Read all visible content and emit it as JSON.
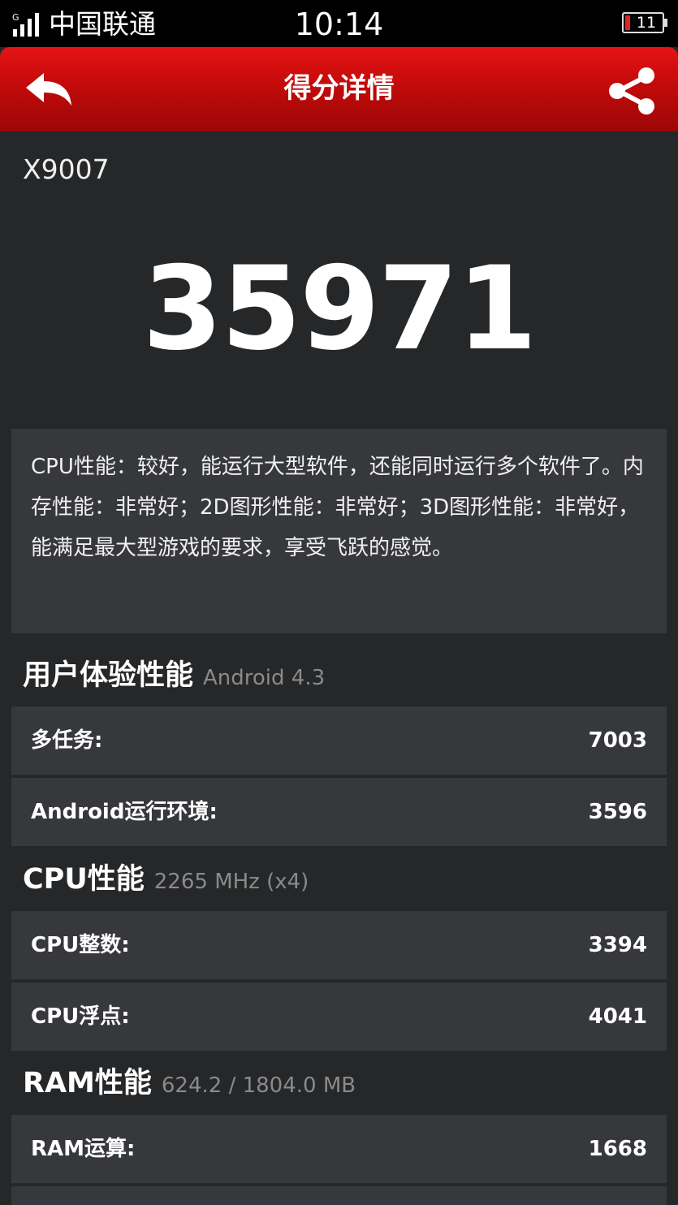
{
  "status_bar": {
    "carrier": "中国联通",
    "time": "10:14",
    "battery": "11",
    "battery_color": "#e52323",
    "signal_icon": "signal-bars-icon"
  },
  "header": {
    "title": "得分详情",
    "back_icon": "back-arrow-icon",
    "share_icon": "share-icon",
    "accent": "#c30a0a"
  },
  "device_name": "X9007",
  "total_score": "35971",
  "description": "CPU性能：较好，能运行大型软件，还能同时运行多个软件了。内存性能：非常好；2D图形性能：非常好；3D图形性能：非常好，能满足最大型游戏的要求，享受飞跃的感觉。",
  "sections": [
    {
      "title": "用户体验性能",
      "subtitle": "Android 4.3",
      "rows": [
        {
          "label": "多任务:",
          "value": "7003"
        },
        {
          "label": "Android运行环境:",
          "value": "3596"
        }
      ]
    },
    {
      "title": "CPU性能",
      "subtitle": "2265 MHz (x4)",
      "rows": [
        {
          "label": "CPU整数:",
          "value": "3394"
        },
        {
          "label": "CPU浮点:",
          "value": "4041"
        }
      ]
    },
    {
      "title": "RAM性能",
      "subtitle": "624.2 / 1804.0 MB",
      "rows": [
        {
          "label": "RAM运算:",
          "value": "1668"
        }
      ]
    }
  ]
}
